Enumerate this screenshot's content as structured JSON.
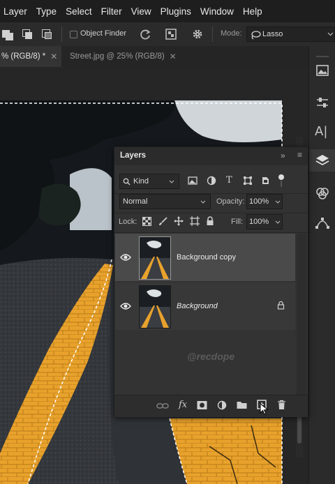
{
  "menu": [
    "Layer",
    "Type",
    "Select",
    "Filter",
    "View",
    "Plugins",
    "Window",
    "Help"
  ],
  "options_bar": {
    "object_finder_label": "Object Finder",
    "mode_label": "Mode:",
    "mode_value": "Lasso"
  },
  "tabs": [
    {
      "label": "% (RGB/8) *",
      "active": true
    },
    {
      "label": "Street.jpg @ 25% (RGB/8)",
      "active": false
    }
  ],
  "layers_panel": {
    "title": "Layers",
    "filter_kind": "Kind",
    "blend_mode": "Normal",
    "opacity_label": "Opacity:",
    "opacity_value": "100%",
    "lock_label": "Lock:",
    "fill_label": "Fill:",
    "fill_value": "100%",
    "layers": [
      {
        "name": "Background copy",
        "visible": true,
        "selected": true,
        "locked": false
      },
      {
        "name": "Background",
        "visible": true,
        "selected": false,
        "locked": true
      }
    ],
    "watermark": "@recdope",
    "footer_fx": "fx"
  },
  "colors": {
    "menubar_bg": "#1e1e1e",
    "panel_bg": "#323232",
    "selected_layer_bg": "#4a4a4a",
    "road_line_yellow": "#e8a22c"
  }
}
